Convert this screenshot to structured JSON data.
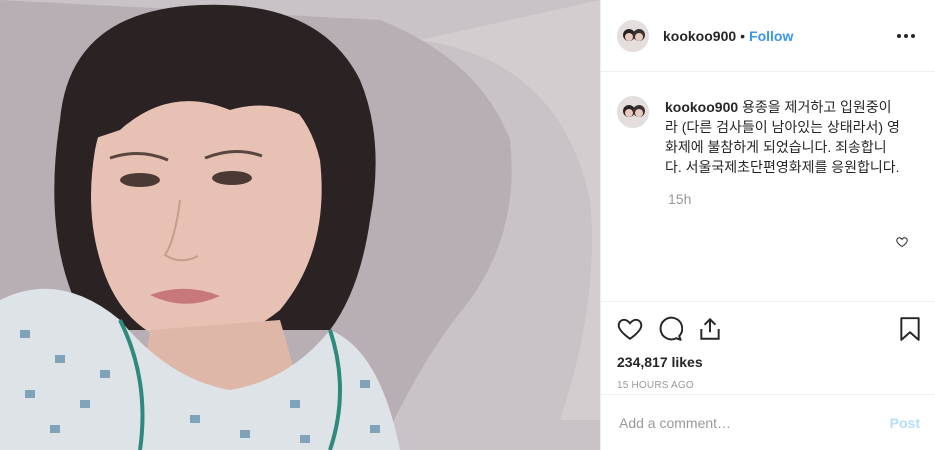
{
  "post": {
    "username": "kookoo900",
    "separator": "•",
    "follow_label": "Follow",
    "more_icon": "more-dots-icon"
  },
  "caption": {
    "username": "kookoo900",
    "text": "용종을 제거하고 입원중이라 (다른 검사들이 남아있는 상태라서) 영화제에 불참하게 되었습니다. 죄송합니다. 서울국제초단편영화제를 응원합니다.",
    "time": "15h"
  },
  "actions": {
    "icons": [
      "heart-icon",
      "comment-icon",
      "share-icon",
      "bookmark-icon"
    ],
    "likes": "234,817 likes",
    "time_ago": "15 HOURS AGO"
  },
  "comment_box": {
    "placeholder": "Add a comment…",
    "post_label": "Post"
  },
  "colors": {
    "link": "#3897f0",
    "post_disabled": "#b2dffc",
    "muted": "#999999",
    "border": "#efefef"
  }
}
